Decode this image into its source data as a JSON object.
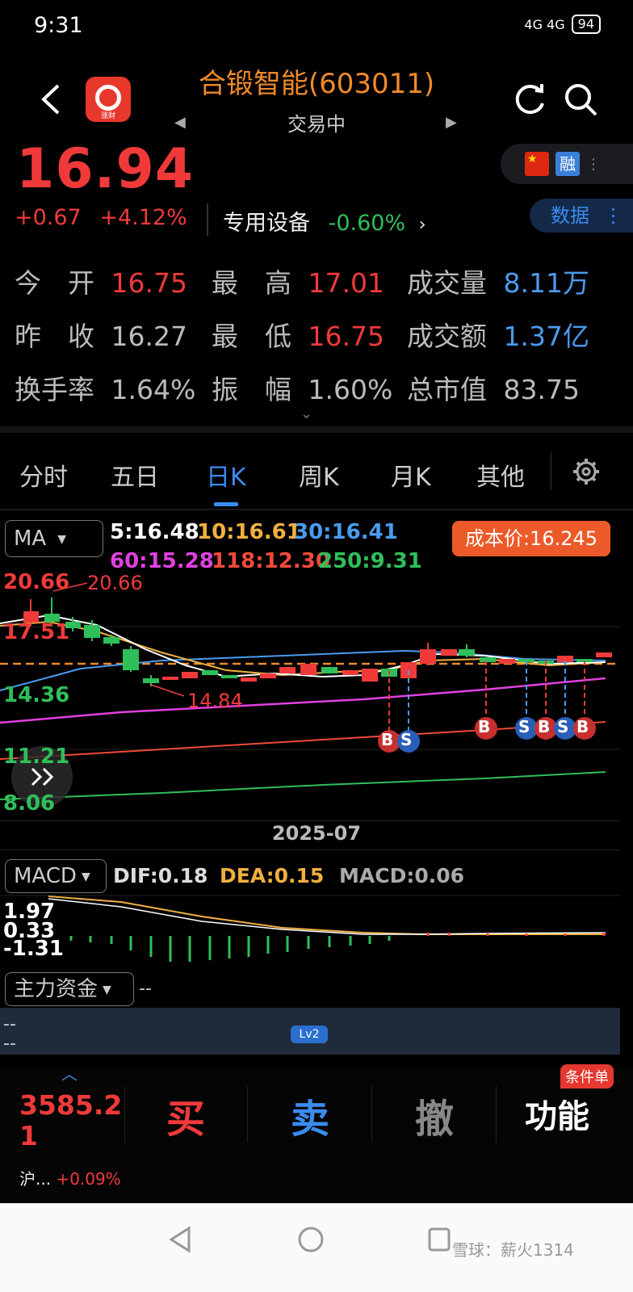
{
  "status_bar": {
    "time": "9:31",
    "network": "4G 4G",
    "battery": "94"
  },
  "header": {
    "logo_label": "涨财",
    "title": "合锻智能(603011)",
    "status": "交易中"
  },
  "quote": {
    "price": "16.94",
    "change": "+0.67",
    "change_pct": "+4.12%",
    "sector": "专用设备",
    "sector_change": "-0.60%",
    "badge_rong": "融",
    "data_button": "数据"
  },
  "stats": {
    "open_label": "今　开",
    "open": "16.75",
    "high_label": "最　高",
    "high": "17.01",
    "volume_label": "成交量",
    "volume": "8.11万",
    "prev_close_label": "昨　收",
    "prev_close": "16.27",
    "low_label": "最　低",
    "low": "16.75",
    "amount_label": "成交额",
    "amount": "1.37亿",
    "turnover_label": "换手率",
    "turnover": "1.64%",
    "amplitude_label": "振　幅",
    "amplitude": "1.60%",
    "mktcap_label": "总市值",
    "mktcap": "83.75"
  },
  "tabs": [
    "分时",
    "五日",
    "日K",
    "周K",
    "月K",
    "其他"
  ],
  "active_tab": "日K",
  "ma": {
    "selector": "MA",
    "ma5": "5:16.48",
    "ma10": "10:16.61",
    "ma30": "30:16.41",
    "ma60": "60:15.28",
    "ma118": "118:12.30",
    "ma250": "250:9.31",
    "cost_price": "成本价:16.245"
  },
  "chart_y_labels": {
    "high_marker": "20.66",
    "high_marker_annot": "20.66",
    "y1": "17.51",
    "y2": "14.36",
    "low_marker_annot": "14.84",
    "y3": "11.21",
    "y4": "8.06"
  },
  "trade_signals": [
    "B",
    "S",
    "B",
    "S",
    "B",
    "S",
    "B"
  ],
  "date_label": "2025-07",
  "macd": {
    "selector": "MACD",
    "dif": "DIF:0.18",
    "dea": "DEA:0.15",
    "macd": "MACD:0.06",
    "y_top": "1.97",
    "y_mid": "0.33",
    "y_bot": "-1.31"
  },
  "fund_flow": {
    "selector": "主力资金",
    "value": "--",
    "row1": "--",
    "row2": "--",
    "lock_label": "Lv2"
  },
  "bottom_bar": {
    "index_value": "3585.21",
    "index_name": "沪...",
    "index_change": "+0.09%",
    "buy": "买",
    "sell": "卖",
    "cancel": "撤",
    "function": "功能",
    "condition_badge": "条件单"
  },
  "watermark": "雪球：薪火1314",
  "colors": {
    "up": "#f03a3a",
    "down": "#2fbf5a",
    "accent": "#3a8cf0",
    "title": "#f08a2a",
    "ma5": "#ffffff",
    "ma10": "#f0b040",
    "ma30": "#4a9bf0",
    "ma60": "#e040e0",
    "ma118": "#f04a3a",
    "ma250": "#2fbf5a"
  }
}
